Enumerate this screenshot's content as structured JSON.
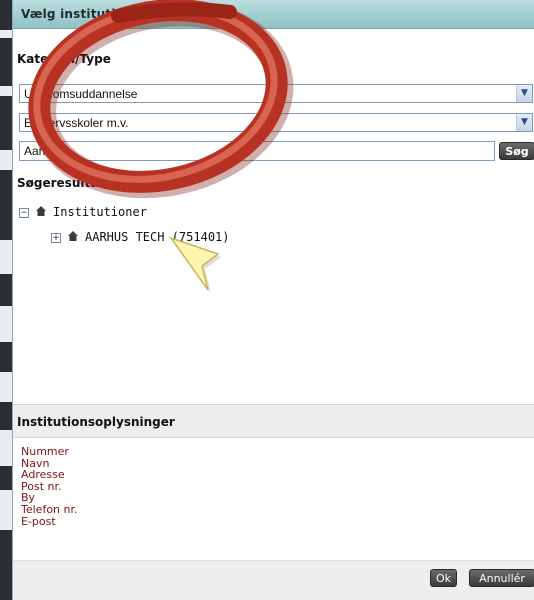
{
  "dialog": {
    "title": "Vælg institution"
  },
  "category_section": {
    "heading": "Kategori/Type",
    "select_category": "Ungdomsuddannelse",
    "select_type": "Erhvervsskoler m.v."
  },
  "search": {
    "input_value": "Aarhus",
    "button_label": "Søg",
    "results_heading": "Søgeresultat"
  },
  "tree": {
    "root_label": "Institutioner",
    "child_label": "AARHUS TECH (751401)",
    "root_toggle": "−",
    "child_toggle": "+"
  },
  "info": {
    "heading": "Institutionsoplysninger",
    "fields": [
      "Nummer",
      "Navn",
      "Adresse",
      "Post nr.",
      "By",
      "Telefon nr.",
      "E-post"
    ]
  },
  "footer": {
    "ok_label": "Ok",
    "cancel_label": "Annullér"
  },
  "colors": {
    "titlebar": "#a8d2d4",
    "info_text": "#7a1616",
    "annotation_ring": "#c0392b",
    "pointer": "#fff5b0"
  },
  "icons": [
    "house-icon",
    "expand-toggle-icon",
    "dropdown-arrow-icon",
    "pointer-arrow-icon"
  ]
}
